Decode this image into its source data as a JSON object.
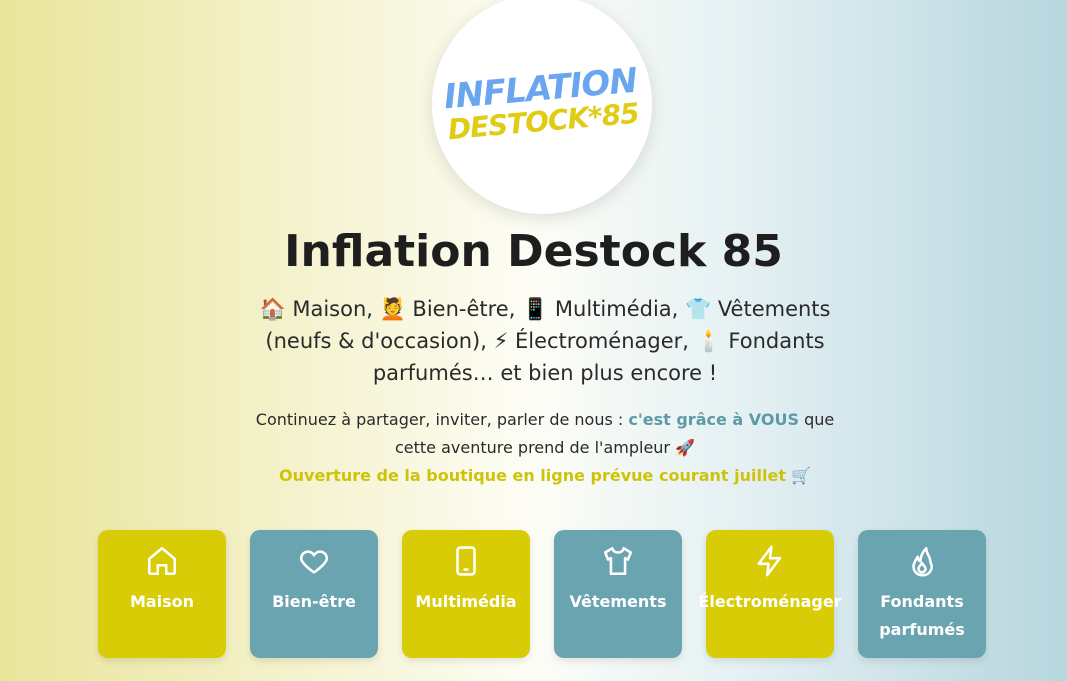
{
  "logo": {
    "line1": "INFLATION",
    "line2": "DESTOCK*85"
  },
  "title": "Inflation Destock 85",
  "subtitle": {
    "line1": "🏠 Maison, 💆 Bien-être, 📱 Multimédia, 👕 Vêtements",
    "line2": "(neufs & d'occasion), ⚡ Électroménager, 🕯️ Fondants",
    "line3": "parfumés… et bien plus encore !"
  },
  "note": {
    "part1": "Continuez à partager, inviter, parler de nous : ",
    "highlight": "c'est grâce à VOUS",
    "part2": " que",
    "line2": "cette aventure prend de l'ampleur 🚀"
  },
  "opening": {
    "text": "Ouverture de la boutique en ligne prévue courant juillet",
    "emoji": " 🛒"
  },
  "categories": [
    {
      "label": "Maison",
      "icon": "house-icon",
      "color": "#d7cc05"
    },
    {
      "label": "Bien-être",
      "icon": "heart-icon",
      "color": "#6aa4b0"
    },
    {
      "label": "Multimédia",
      "icon": "smartphone-icon",
      "color": "#d7cc05"
    },
    {
      "label": "Vêtements",
      "icon": "shirt-icon",
      "color": "#6aa4b0"
    },
    {
      "label": "Électroménager",
      "icon": "lightning-icon",
      "color": "#d7cc05"
    },
    {
      "label": "Fondants parfumés",
      "icon": "flame-icon",
      "color": "#6aa4b0"
    }
  ]
}
